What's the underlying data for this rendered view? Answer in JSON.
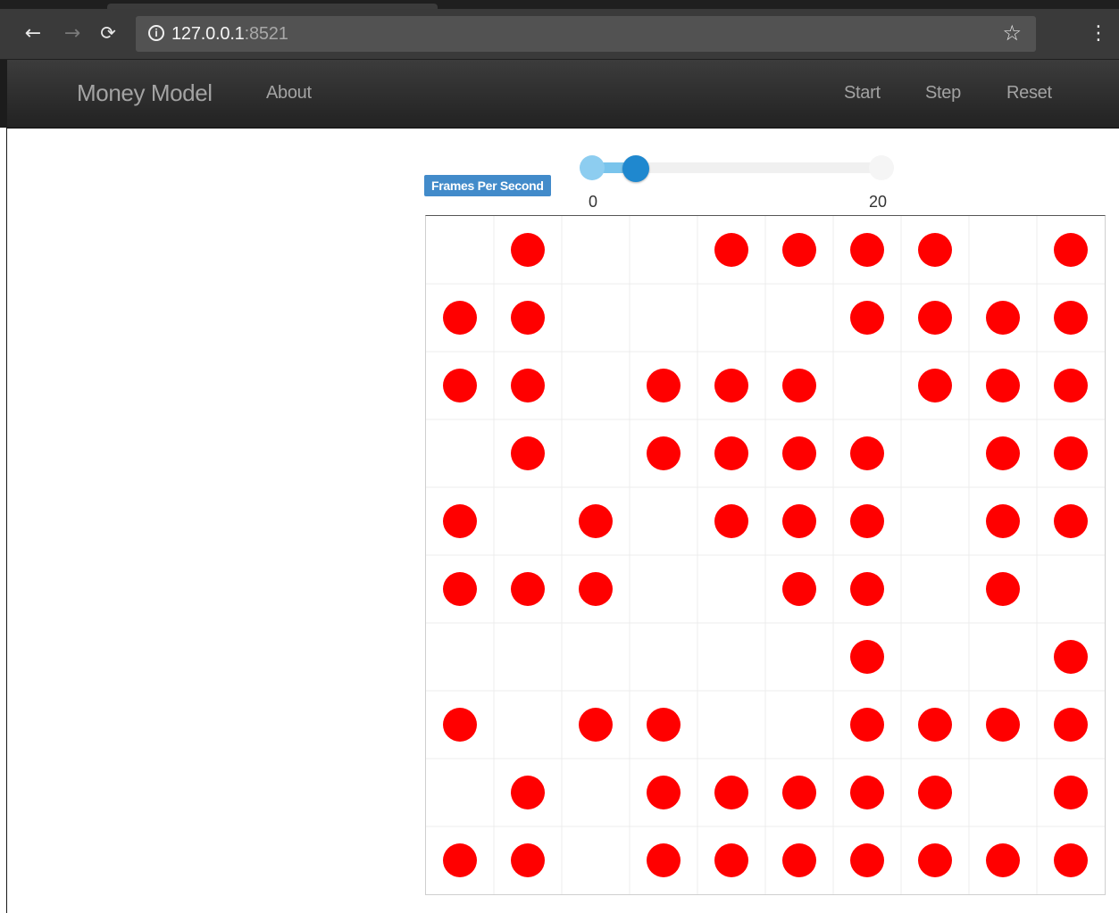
{
  "browser": {
    "url_host": "127.0.0.1",
    "url_port": ":8521",
    "back_icon": "arrow-left-icon",
    "forward_icon": "arrow-right-icon",
    "reload_icon": "reload-icon",
    "info_icon": "info-icon",
    "star_icon": "star-icon",
    "menu_icon": "kebab-menu-icon"
  },
  "navbar": {
    "brand": "Money Model",
    "about": "About",
    "start": "Start",
    "step": "Step",
    "reset": "Reset"
  },
  "fps_control": {
    "label": "Frames Per Second",
    "min": 0,
    "max": 20,
    "value": 3,
    "min_label": "0",
    "max_label": "20",
    "accent_color": "#1f88cf",
    "label_color": "#428bca"
  },
  "grid": {
    "columns": 10,
    "rows": 10,
    "agent_color": "#ff0000",
    "gridline_color": "#ececec",
    "occupancy": [
      [
        0,
        1,
        0,
        0,
        1,
        1,
        1,
        1,
        0,
        1
      ],
      [
        1,
        1,
        0,
        0,
        0,
        0,
        1,
        1,
        1,
        1
      ],
      [
        1,
        1,
        0,
        1,
        1,
        1,
        0,
        1,
        1,
        1
      ],
      [
        0,
        1,
        0,
        1,
        1,
        1,
        1,
        0,
        1,
        1
      ],
      [
        1,
        0,
        1,
        0,
        1,
        1,
        1,
        0,
        1,
        1
      ],
      [
        1,
        1,
        1,
        0,
        0,
        1,
        1,
        0,
        1,
        0
      ],
      [
        0,
        0,
        0,
        0,
        0,
        0,
        1,
        0,
        0,
        1
      ],
      [
        1,
        0,
        1,
        1,
        0,
        0,
        1,
        1,
        1,
        1
      ],
      [
        0,
        1,
        0,
        1,
        1,
        1,
        1,
        1,
        0,
        1
      ],
      [
        1,
        1,
        0,
        1,
        1,
        1,
        1,
        1,
        1,
        1
      ]
    ]
  }
}
